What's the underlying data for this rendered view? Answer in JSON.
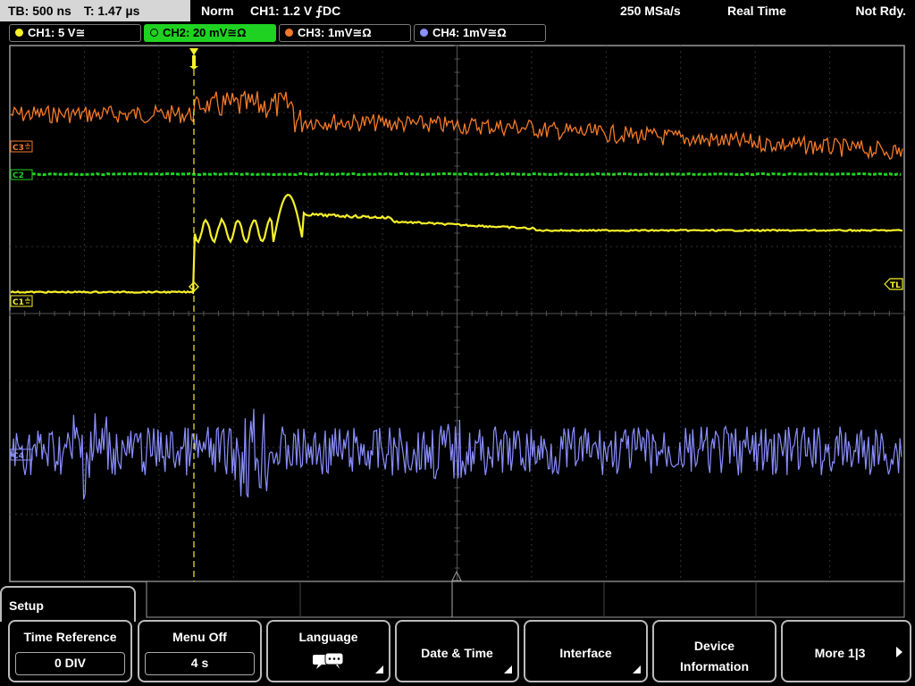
{
  "timebase": {
    "tb": "TB: 500 ns",
    "t": "T: 1.47 µs"
  },
  "status": {
    "mode": "Norm",
    "trigger": "CH1: 1.2 V ⨍DC",
    "sample_rate": "250 MSa/s",
    "acq": "Real Time",
    "state": "Not Rdy."
  },
  "channels": [
    {
      "label": "CH1: 5 V≅",
      "color": "#f7f12a",
      "active": false
    },
    {
      "label": "CH2: 20 mV≅Ω",
      "color": "#1fd222",
      "active": true
    },
    {
      "label": "CH3: 1mV≅Ω",
      "color": "#f47a28",
      "active": false
    },
    {
      "label": "CH4: 1mV≅Ω",
      "color": "#8a8fff",
      "active": false
    }
  ],
  "markers": {
    "c3": "C3",
    "c2": "C2",
    "c1": "C1",
    "c4": "C4",
    "tl": "TL"
  },
  "menu": {
    "title": "Setup",
    "time_reference": {
      "label": "Time Reference",
      "value": "0 DIV"
    },
    "menu_off": {
      "label": "Menu Off",
      "value": "4 s"
    },
    "language": "Language",
    "date_time": "Date & Time",
    "interface": "Interface",
    "device_info_1": "Device",
    "device_info_2": "Information",
    "more": "More 1|3"
  }
}
